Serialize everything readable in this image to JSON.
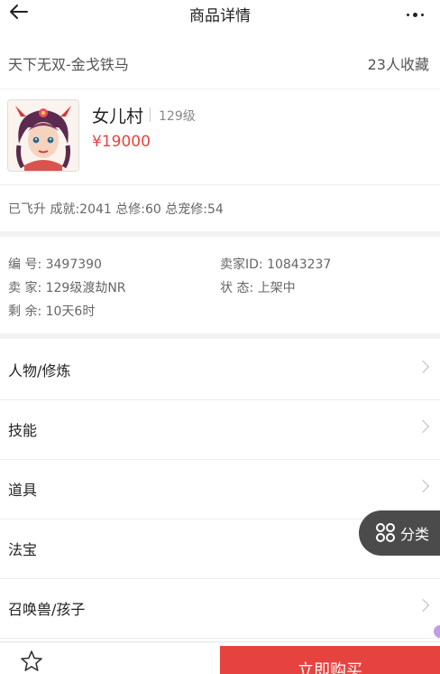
{
  "header": {
    "title": "商品详情"
  },
  "listing": {
    "name": "天下无双-金戈铁马",
    "favorites": "23人收藏"
  },
  "character": {
    "school": "女儿村",
    "level": "129级",
    "price": "¥19000"
  },
  "achievements": "已飞升 成就:2041 总修:60 总宠修:54",
  "details": {
    "id": "编 号: 3497390",
    "seller_id": "卖家ID: 10843237",
    "seller": "卖 家: 129级渡劫NR",
    "status": "状 态: 上架中",
    "remaining": "剩 余: 10天6时"
  },
  "menu": [
    {
      "label": "人物/修炼"
    },
    {
      "label": "技能"
    },
    {
      "label": "道具"
    },
    {
      "label": "法宝"
    },
    {
      "label": "召唤兽/孩子"
    }
  ],
  "category_button": {
    "label": "分类"
  },
  "footer": {
    "buy_label": "立即购买"
  },
  "colors": {
    "accent": "#e64340",
    "fab": "#4b4b4b",
    "divider": "#f2f2f2"
  },
  "icons": [
    "back-arrow-icon",
    "more-dots-icon",
    "chevron-right-icon",
    "category-grid-icon",
    "star-icon"
  ]
}
